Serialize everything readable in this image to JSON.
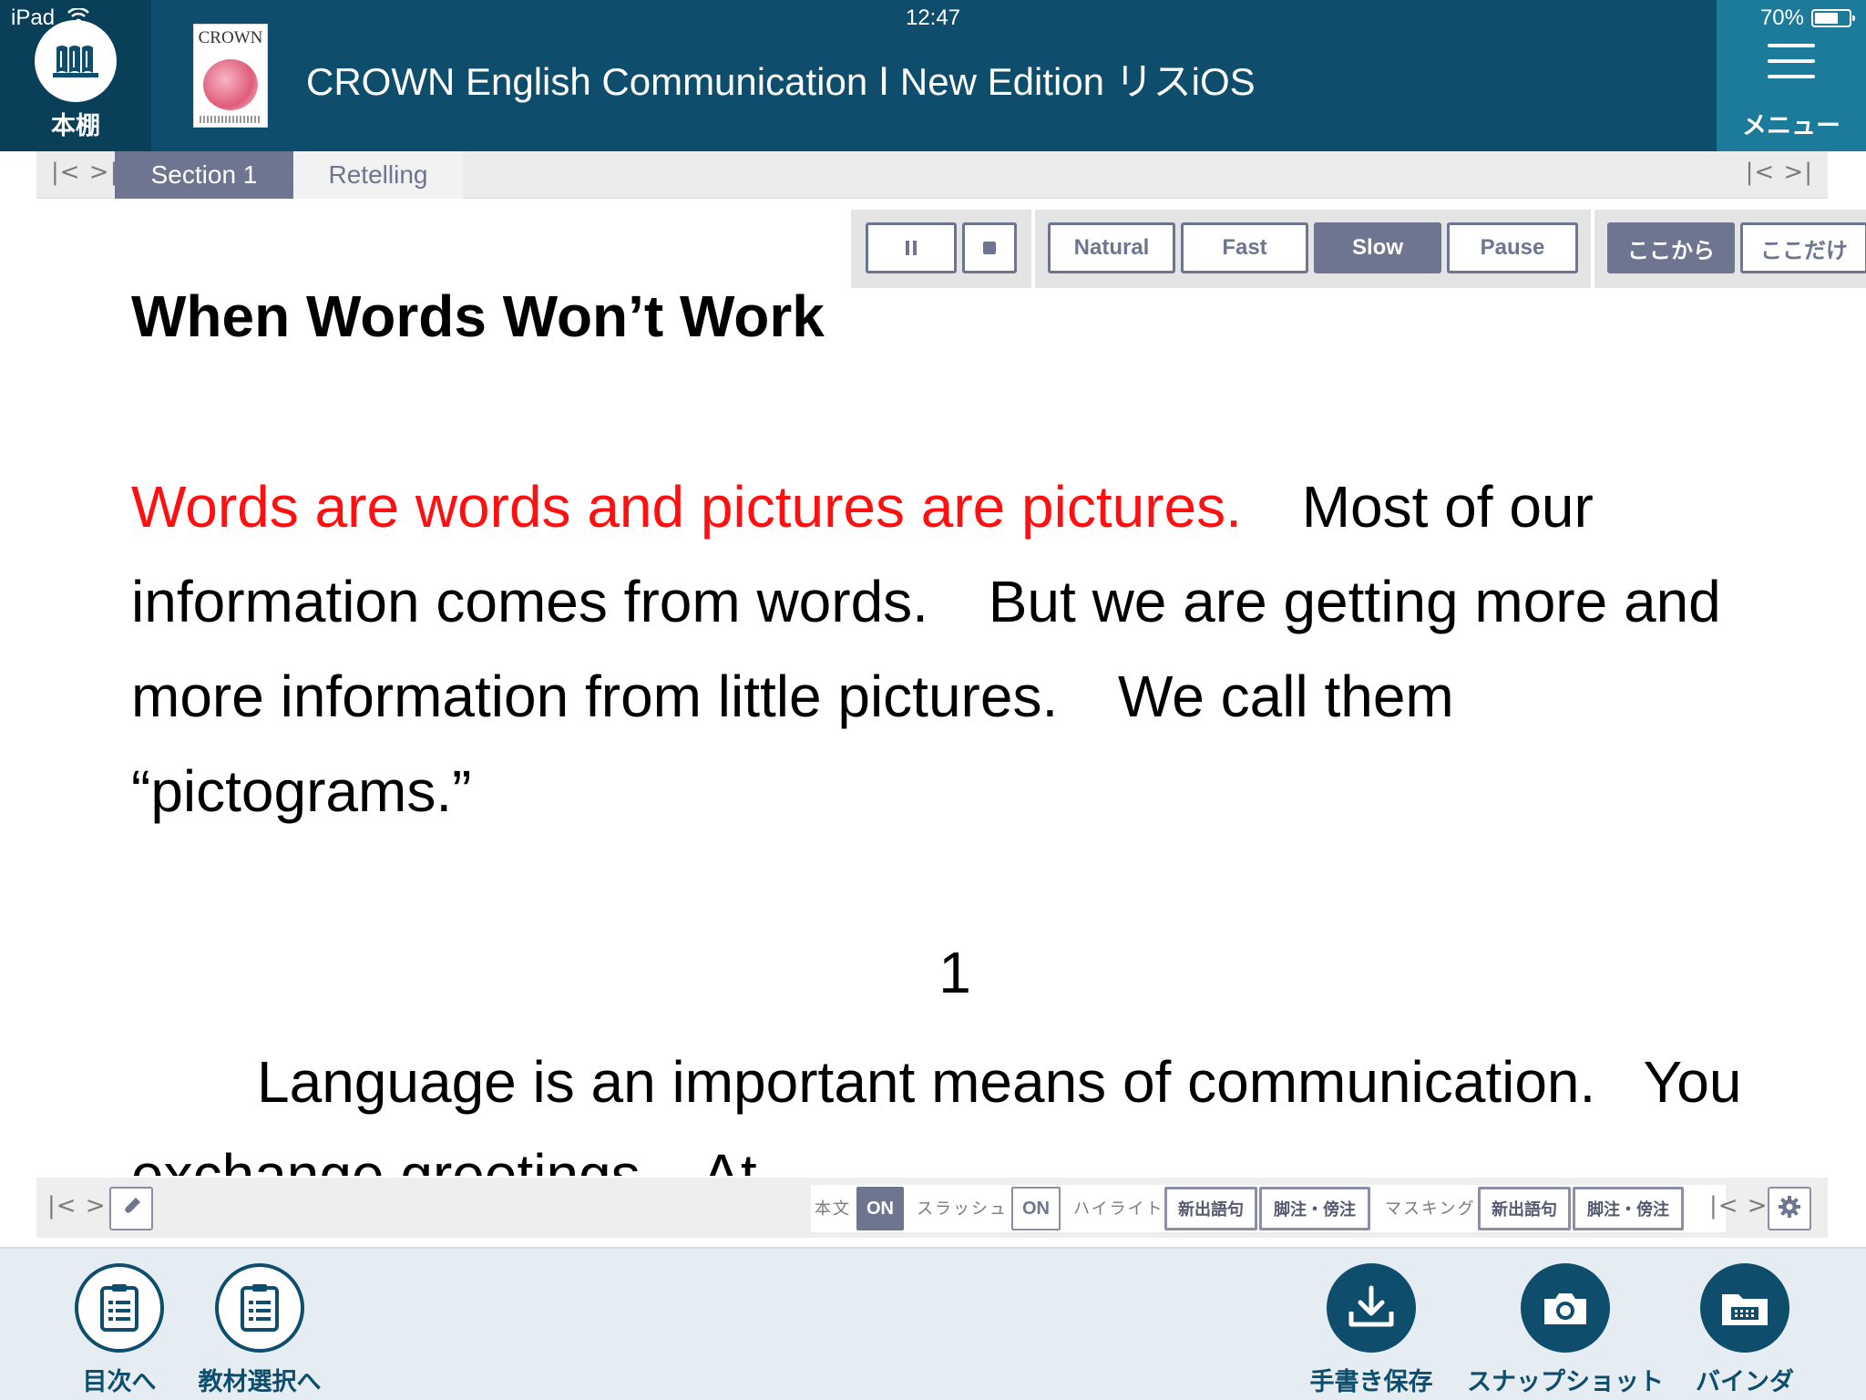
{
  "status_bar": {
    "device": "iPad",
    "time": "12:47",
    "battery_text": "70%",
    "battery_level": 0.7
  },
  "header": {
    "bookshelf_label": "本棚",
    "book_cover_title": "CROWN",
    "title": "CROWN English Communication Ⅰ New Edition リスiOS",
    "menu_label": "メニュー"
  },
  "tabs": {
    "nav": "|< >|",
    "items": [
      {
        "label": "Section 1",
        "active": true
      },
      {
        "label": "Retelling",
        "active": false
      }
    ]
  },
  "audio_toolbar": {
    "speeds": [
      "Natural",
      "Fast",
      "Slow",
      "Pause"
    ],
    "active_speed": "Slow",
    "range_buttons": [
      "ここから",
      "ここだけ"
    ]
  },
  "content": {
    "heading": "When Words Won’t Work",
    "paragraph1": [
      {
        "text": "Words are words and pictures are pictures.",
        "highlight": true
      },
      {
        "text": "Most of our information comes from words.",
        "highlight": false
      },
      {
        "text": "But we are getting more and more information from little pictures.",
        "highlight": false
      },
      {
        "text": "We call them “pictograms.”",
        "highlight": false
      }
    ],
    "page_number": "1",
    "paragraph2": "Language is an important means of communication.   You exchange greetings.   At"
  },
  "settings_bar": {
    "nav": "|< >|",
    "honbun_label": "本文",
    "honbun_state": "ON",
    "slash_label": "スラッシュ",
    "slash_state": "ON",
    "highlight_label": "ハイライト",
    "highlight_options": [
      "新出語句",
      "脚注・傍注"
    ],
    "masking_label": "マスキング",
    "masking_options": [
      "新出語句",
      "脚注・傍注"
    ]
  },
  "action_bar": {
    "toc": "目次へ",
    "material_select": "教材選択へ",
    "save_handwriting": "手書き保存",
    "snapshot": "スナップショット",
    "binder": "バインダ"
  },
  "colors": {
    "header": "#0e4d6b",
    "accent": "#6e7590",
    "highlight_text": "#ff0f0f"
  }
}
